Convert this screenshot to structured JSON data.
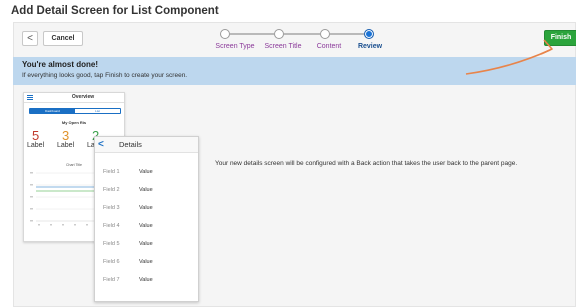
{
  "page": {
    "title": "Add Detail Screen for List Component"
  },
  "toolbar": {
    "back_glyph": "<",
    "cancel_label": "Cancel",
    "finish_label": "Finish"
  },
  "steps": [
    {
      "label": "Screen Type",
      "state": "done"
    },
    {
      "label": "Screen Title",
      "state": "done"
    },
    {
      "label": "Content",
      "state": "done"
    },
    {
      "label": "Review",
      "state": "active"
    }
  ],
  "banner": {
    "title": "You're almost done!",
    "message": "If everything looks good, tap Finish to create your screen."
  },
  "preview_list": {
    "menu_icon": "hamburger-icon",
    "title": "Overview",
    "tabs": [
      "Dashboard",
      "List"
    ],
    "subtitle": "My Open Ris",
    "kpis": [
      {
        "value": "5",
        "label": "Label",
        "color": "#c0392b"
      },
      {
        "value": "3",
        "label": "Label",
        "color": "#e0922a"
      },
      {
        "value": "2",
        "label": "Label",
        "color": "#3aa14a"
      }
    ],
    "chart_title": "Chart Title"
  },
  "preview_detail": {
    "back_glyph": "<",
    "title": "Details",
    "rows": [
      {
        "field": "Field 1",
        "value": "Value"
      },
      {
        "field": "Field 2",
        "value": "Value"
      },
      {
        "field": "Field 3",
        "value": "Value"
      },
      {
        "field": "Field 4",
        "value": "Value"
      },
      {
        "field": "Field 5",
        "value": "Value"
      },
      {
        "field": "Field 6",
        "value": "Value"
      },
      {
        "field": "Field 7",
        "value": "Value"
      }
    ]
  },
  "description": "Your new details screen will be configured with a Back action that takes the user back to the parent page.",
  "colors": {
    "finish": "#2ba43c",
    "banner": "#bdd7ee",
    "step_active": "#1a73d6",
    "arrow": "#e8844a"
  }
}
